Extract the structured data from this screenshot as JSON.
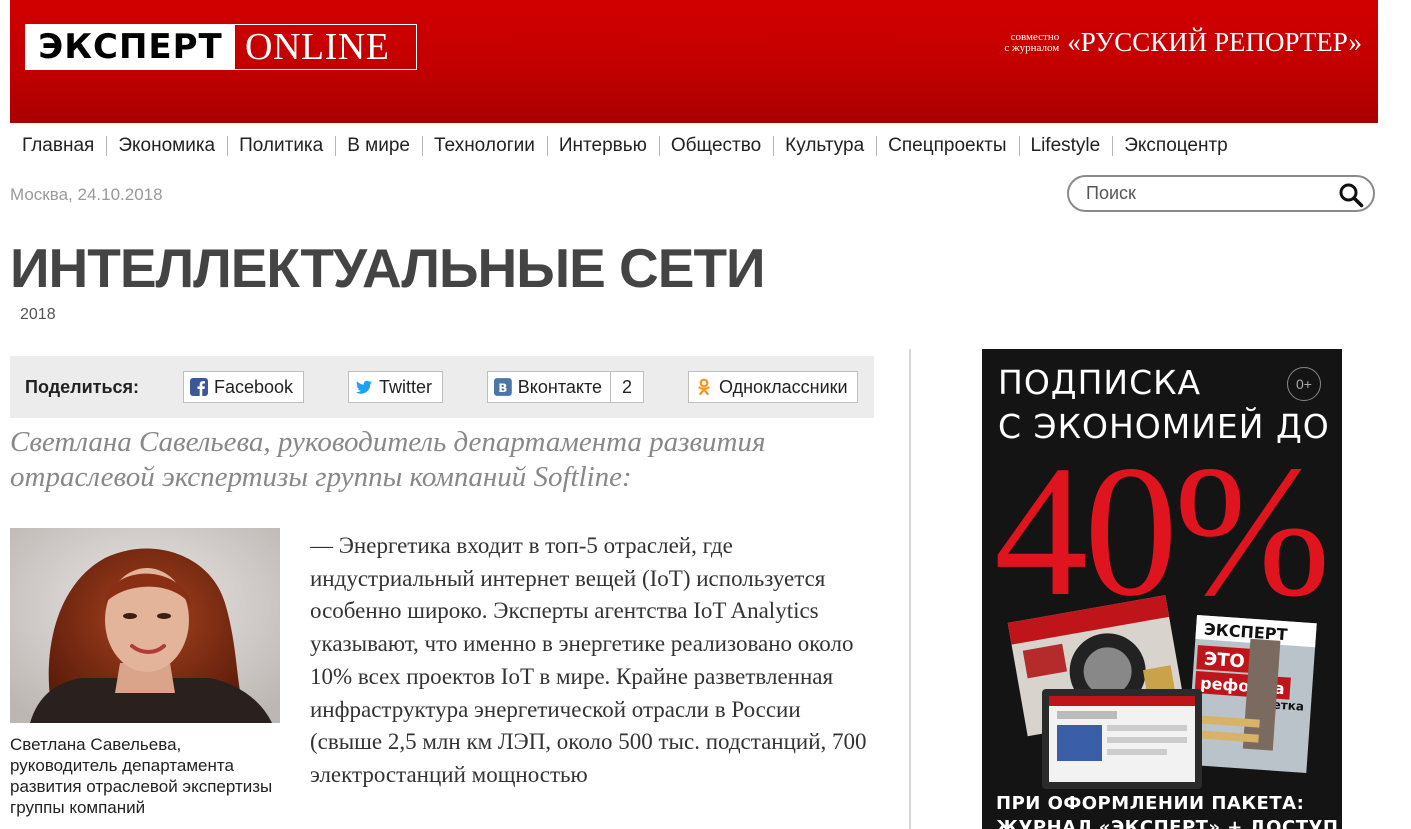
{
  "header": {
    "logo_left": "ЭКСПЕРТ",
    "logo_right": "ONLINE",
    "partner_line1": "совместно",
    "partner_line2": "с журналом",
    "partner_name": "«РУССКИЙ РЕПОРТЕР»"
  },
  "nav": {
    "items": [
      "Главная",
      "Экономика",
      "Политика",
      "В мире",
      "Технологии",
      "Интервью",
      "Общество",
      "Культура",
      "Спецпроекты",
      "Lifestyle",
      "Экспоцентр"
    ]
  },
  "meta": {
    "date": "Москва, 24.10.2018"
  },
  "search": {
    "placeholder": "Поиск"
  },
  "article": {
    "title": "ИНТЕЛЛЕКТУАЛЬНЫЕ СЕТИ",
    "year": "2018",
    "author_heading": "Светлана Савельева, руководитель департамента развития отраслевой экспертизы группы компаний Softline:",
    "photo_caption": "Светлана Савельева, руководитель департамента развития отраслевой экспертизы группы компаний",
    "body": "— Энергетика входит в топ-5 отраслей, где индустриальный интернет вещей (IoT) используется особенно широко. Эксперты агентства IoT Analytics указывают, что именно в энергетике реализовано около 10% всех проектов IoT в мире. Крайне разветвленная инфраструктура энергетической отрасли в России (свыше 2,5 млн км ЛЭП, около 500 тыс. подстанций, 700 электростанций мощностью"
  },
  "share": {
    "label": "Поделиться:",
    "facebook": "Facebook",
    "twitter": "Twitter",
    "vkontakte": "Вконтакте",
    "vkontakte_count": "2",
    "odnoklassniki": "Одноклассники"
  },
  "ad": {
    "line1": "ПОДПИСКА",
    "line2": "С ЭКОНОМИЕЙ ДО",
    "percent": "40%",
    "age": "0+",
    "magazine_logo": "ЭКСПЕРТ",
    "cover_text1": "ЭТО",
    "cover_text2": "реформа",
    "cover_text3": "детка",
    "footer1": "ПРИ ОФОРМЛЕНИИ ПАКЕТА:",
    "footer2": "ЖУРНАЛ «ЭКСПЕРТ» + ДОСТУП КО"
  },
  "colors": {
    "brand_red": "#c40000",
    "ad_red": "#e0141e",
    "facebook": "#3b5998",
    "twitter": "#1da1f2",
    "vkontakte": "#4a76a8",
    "odnoklassniki": "#f7931e"
  }
}
